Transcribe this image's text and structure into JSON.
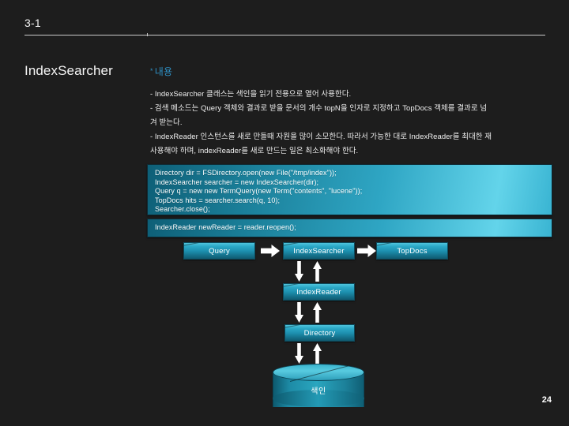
{
  "slide": {
    "header_number": "3-1",
    "title": "IndexSearcher",
    "page_number": "24"
  },
  "section": {
    "star": "*",
    "heading": "내용"
  },
  "body": {
    "lines": [
      "- IndexSearcher 클래스는 색인을 읽기 전용으로 열어 사용한다.",
      "- 검색 메소드는 Query 객체와 결과로 받을 문서의 개수 topN을 인자로 지정하고 TopDocs 객체를 결과로 넘",
      "겨 받는다.",
      "- IndexReader 인스턴스를 새로 만들때 자원을 많이 소모한다. 따라서 가능한 대로 IndexReader를 최대한 재",
      "사용해야 하며, indexReader를 새로 만드는 일은 최소화해야 한다."
    ]
  },
  "code_blocks": [
    {
      "name": "search-snippet",
      "lines": [
        "Directory dir = FSDirectory.open(new File(\"/tmp/index\"));",
        "IndexSearcher searcher = new IndexSearcher(dir);",
        "Query q = new new TermQuery(new Term(\"contents\", \"lucene\"));",
        "TopDocs hits = searcher.search(q, 10);",
        "Searcher.close();"
      ]
    },
    {
      "name": "reopen-snippet",
      "lines": [
        "IndexReader newReader = reader.reopen();"
      ]
    }
  ],
  "diagram": {
    "nodes": {
      "query": "Query",
      "index_searcher": "IndexSearcher",
      "top_docs": "TopDocs",
      "index_reader": "IndexReader",
      "directory": "Directory",
      "index_store": "색인"
    }
  },
  "colors": {
    "background": "#1d1d1d",
    "accent_blue": "#2f90c4",
    "node_teal": "#1d8fae",
    "code_cyan": "#2fa6c4",
    "text": "#efefef"
  }
}
